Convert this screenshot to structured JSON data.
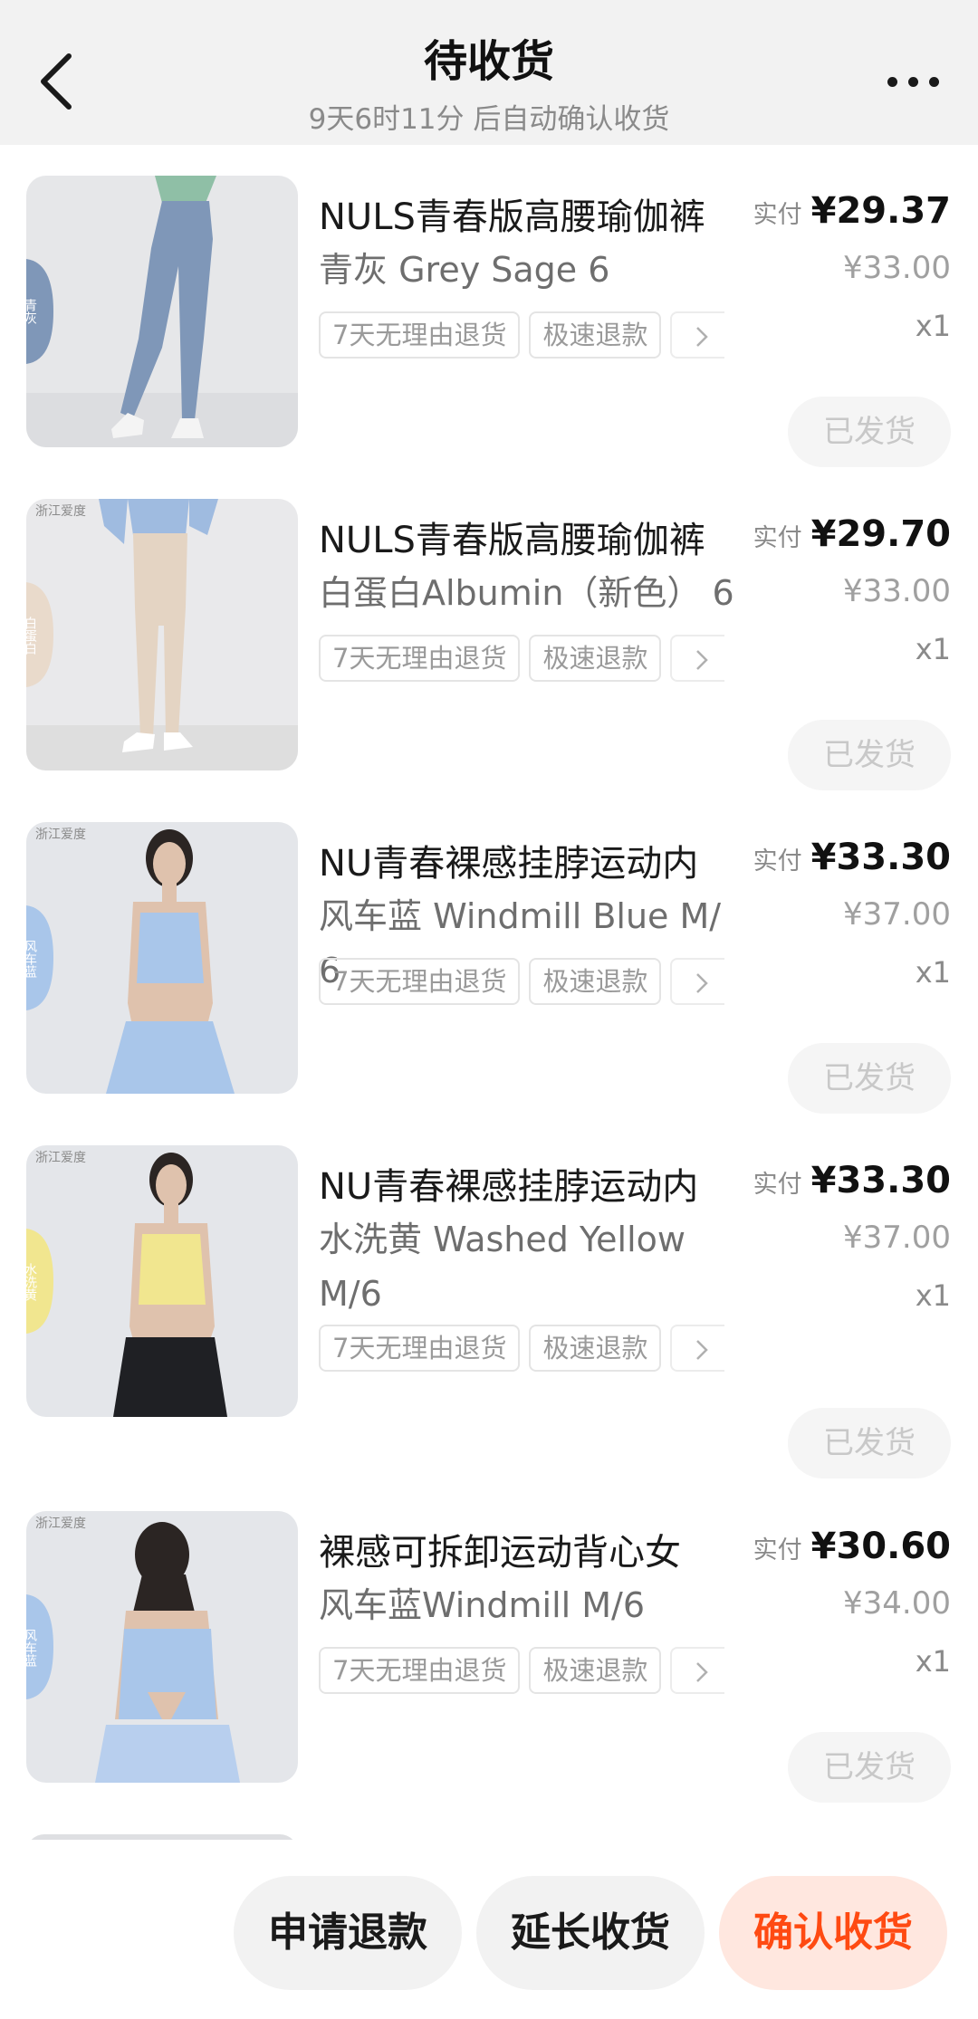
{
  "header": {
    "title": "待收货",
    "subtitle": "9天6时11分 后自动确认收货"
  },
  "items": [
    {
      "title": "NULS青春版高腰瑜伽裤",
      "variant": "青灰 Grey Sage 6",
      "tags": [
        "7天无理由退货",
        "极速退款"
      ],
      "paid_label": "实付",
      "paid_price": "¥29.37",
      "original_price": "¥33.00",
      "quantity": "x1",
      "status_button": "已发货",
      "swatch_text": "青灰",
      "swatch_color": "#7f97b8"
    },
    {
      "title": "NULS青春版高腰瑜伽裤",
      "variant": "白蛋白Albumin（新色） 6",
      "tags": [
        "7天无理由退货",
        "极速退款"
      ],
      "paid_label": "实付",
      "paid_price": "¥29.70",
      "original_price": "¥33.00",
      "quantity": "x1",
      "status_button": "已发货",
      "brand_mark": "浙江爱度",
      "swatch_text": "白蛋白",
      "swatch_color": "#e9dacb"
    },
    {
      "title": "NU青春裸感挂脖运动内",
      "variant": "风车蓝 Windmill Blue M/6",
      "tags": [
        "7天无理由退货",
        "极速退款"
      ],
      "paid_label": "实付",
      "paid_price": "¥33.30",
      "original_price": "¥37.00",
      "quantity": "x1",
      "status_button": "已发货",
      "brand_mark": "浙江爱度",
      "swatch_text": "风车蓝",
      "swatch_color": "#a9c6ea"
    },
    {
      "title": "NU青春裸感挂脖运动内",
      "variant": "水洗黄 Washed Yellow M/6",
      "tags": [
        "7天无理由退货",
        "极速退款"
      ],
      "paid_label": "实付",
      "paid_price": "¥33.30",
      "original_price": "¥37.00",
      "quantity": "x1",
      "status_button": "已发货",
      "brand_mark": "浙江爱度",
      "swatch_text": "水洗黄",
      "swatch_color": "#f1e68f"
    },
    {
      "title": "裸感可拆卸运动背心女",
      "variant": "风车蓝Windmill M/6",
      "tags": [
        "7天无理由退货",
        "极速退款"
      ],
      "paid_label": "实付",
      "paid_price": "¥30.60",
      "original_price": "¥34.00",
      "quantity": "x1",
      "status_button": "已发货",
      "brand_mark": "浙江爱度",
      "swatch_text": "风车蓝",
      "swatch_color": "#a9c6ea"
    }
  ],
  "bottom_bar": {
    "refund_label": "申请退款",
    "extend_label": "延长收货",
    "confirm_label": "确认收货"
  },
  "colors": {
    "accent": "#ff4a12",
    "accent_bg": "#ffe7df",
    "header_bg": "#f2f2f2"
  },
  "icons": {
    "back": "chevron-left-icon",
    "more": "more-dots-icon",
    "tag_more": "chevron-right-icon"
  }
}
